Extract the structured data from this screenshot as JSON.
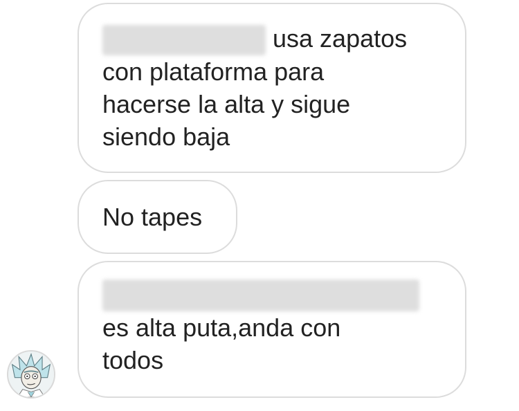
{
  "messages": [
    {
      "id": "msg1",
      "redacted_prefix": true,
      "lines": [
        "usa zapatos",
        "con plataforma para",
        "hacerse la alta y sigue",
        "siendo baja"
      ]
    },
    {
      "id": "msg2",
      "redacted_prefix": false,
      "lines": [
        "No tapes"
      ]
    },
    {
      "id": "msg3",
      "redacted_prefix": true,
      "lines": [
        "es alta puta,anda con",
        "todos"
      ]
    }
  ],
  "avatar": {
    "icon": "cartoon-avatar-icon"
  },
  "colors": {
    "bubble_border": "#dcdcdc",
    "text": "#222222",
    "background": "#ffffff"
  }
}
